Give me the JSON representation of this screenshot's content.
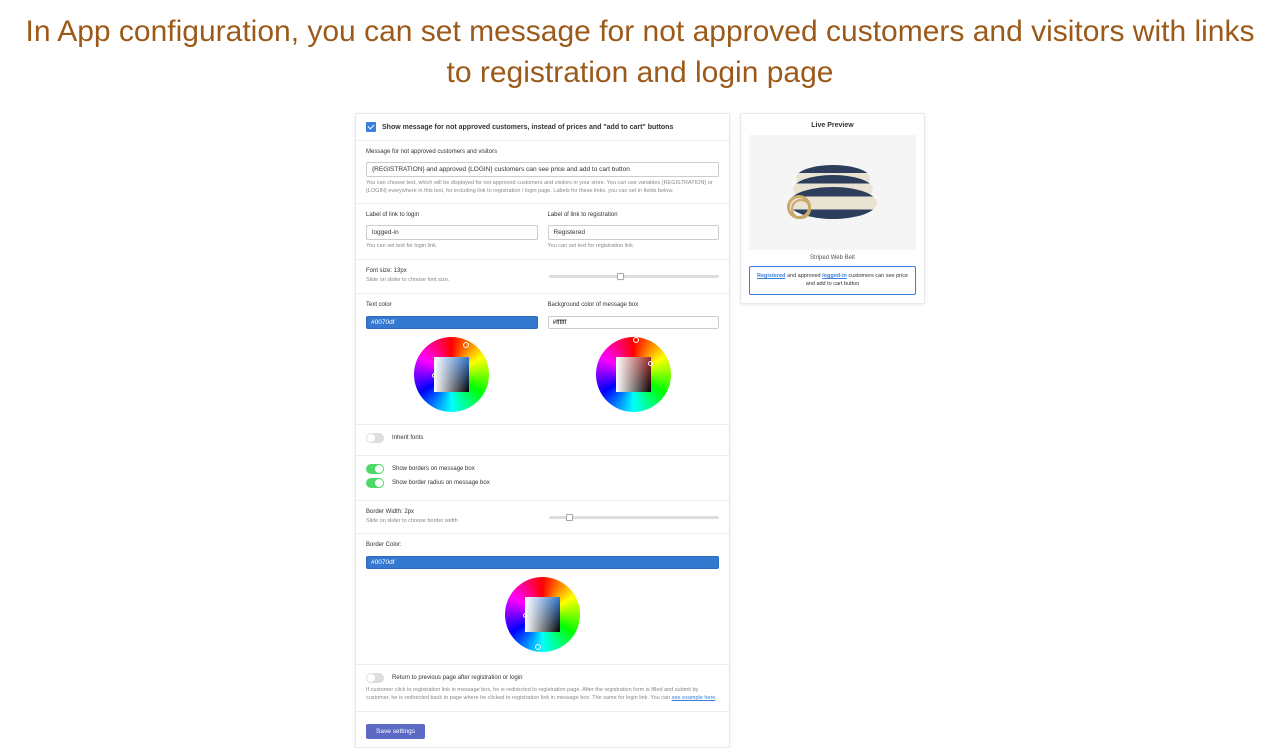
{
  "title": "In App configuration, you can set message for not approved customers and visitors with links to registration and login page",
  "config": {
    "showMessageCheckbox": "Show message for not approved customers, instead of prices and \"add to cart\" buttons",
    "messageLabel": "Message for not approved customers and visitors",
    "messageValue": "{REGISTRATION} and approved {LOGIN} customers can see price and add to cart button",
    "messageHelp": "You can choose text, which will be displayed for not approved customers and visitors in your store. You can use variables {REGISTRATION} or {LOGIN} everywhere in this text, for including link to registration / login page. Labels for these links, you can set in fields below.",
    "loginLinkLabel": "Label of link to login",
    "loginLinkValue": "logged-in",
    "loginLinkHelp": "You can set text for login link.",
    "registrationLinkLabel": "Label of link to registration",
    "registrationLinkValue": "Registered",
    "registrationLinkHelp": "You can set text for registration link.",
    "fontSizeLabel": "Font size: 13px",
    "fontSizeHelp": "Slide on slider to choose font size.",
    "textColorLabel": "Text color",
    "textColorValue": "#0070df",
    "bgColorLabel": "Background color of message box",
    "bgColorValue": "#ffffff",
    "inheritFonts": "Inherit fonts",
    "showBorders": "Show borders on message box",
    "showBorderRadius": "Show border radius on message box",
    "borderWidthLabel": "Border Width: 2px",
    "borderWidthHelp": "Slide on slider to choose border width",
    "borderColorLabel": "Border Color:",
    "borderColorValue": "#0070df",
    "returnPrevious": "Return to previous page after registration or login",
    "returnHelpPre": "If customer click to registration link in message box, he is redirected to registration page. After the registration form is filled and submit by customer, he is redirected back to page where he clicked to registration link in message box. The same for login link. You can ",
    "returnHelpLink": "see example here",
    "saveBtn": "Save settings"
  },
  "preview": {
    "title": "Live Preview",
    "productName": "Striped Web Belt",
    "msgRegLink": "Registered",
    "msgMid": " and approved ",
    "msgLoginLink": "logged-in",
    "msgEnd": " customers can see price and add to cart button"
  }
}
